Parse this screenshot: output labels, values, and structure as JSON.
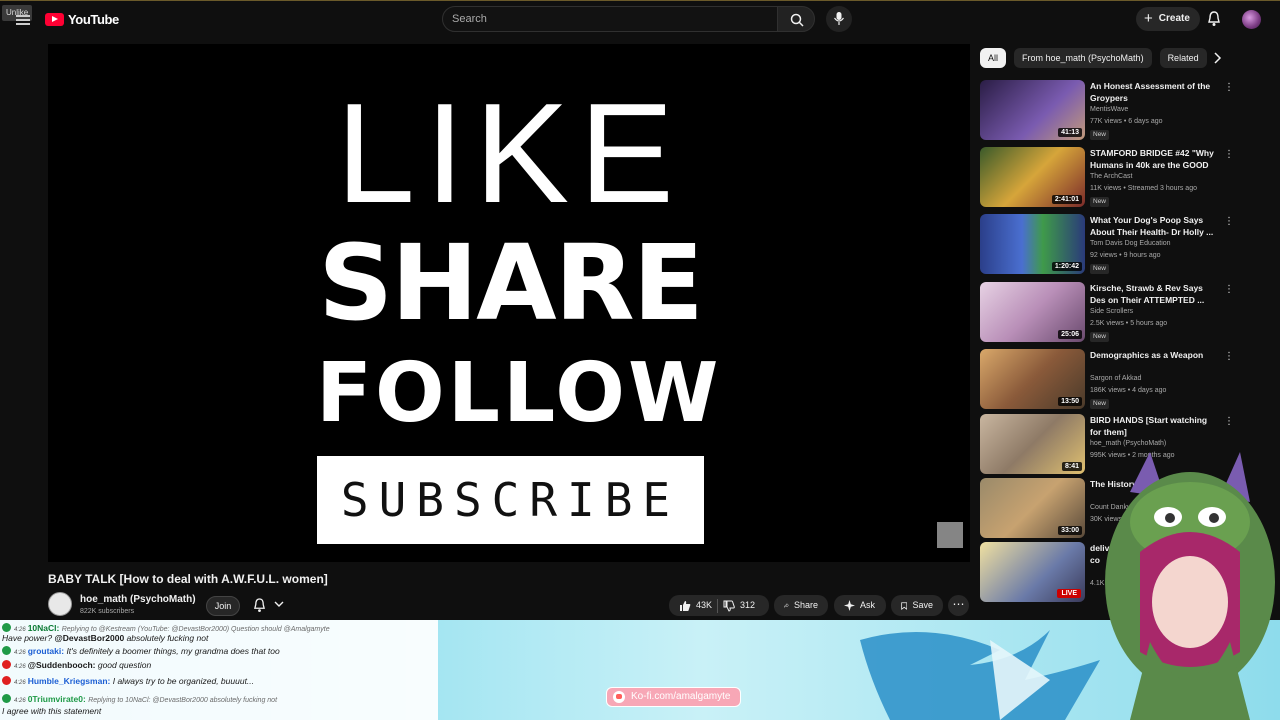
{
  "header": {
    "tooltip": "Unlike",
    "logo_text": "YouTube",
    "search_placeholder": "Search",
    "create_label": "Create",
    "colors": {
      "brand_red": "#ff0033",
      "background": "#0f0f0f"
    }
  },
  "player": {
    "promo_like": "LIKE",
    "promo_share": "SHARE",
    "promo_follow": "FOLLOW",
    "promo_subscribe": "SUBSCRIBE"
  },
  "video": {
    "title": "BABY TALK [How to deal with A.W.F.U.L. women]",
    "channel": "hoe_math (PsychoMath)",
    "subscribers": "822K subscribers",
    "join_label": "Join",
    "likes": "43K",
    "dislikes": "312",
    "share_label": "Share",
    "ask_label": "Ask",
    "save_label": "Save"
  },
  "sidebar": {
    "chips": [
      "All",
      "From hoe_math (PsychoMath)",
      "Related"
    ],
    "items": [
      {
        "title": "An Honest Assessment of the Groypers",
        "channel": "MentisWave",
        "meta": "77K views • 6 days ago",
        "badge": "New",
        "duration": "41:13",
        "thumb_color": "#5a3f7a"
      },
      {
        "title": "STAMFORD BRIDGE #42 \"Why Humans in 40k are the GOOD ...",
        "channel": "The ArchCast",
        "meta": "11K views • Streamed 3 hours ago",
        "badge": "New",
        "duration": "2:41:01",
        "thumb_color": "#b98a2c"
      },
      {
        "title": "What Your Dog's Poop Says About Their Health- Dr Holly ...",
        "channel": "Tom Davis Dog Education",
        "meta": "92 views • 9 hours ago",
        "badge": "New",
        "duration": "1:20:42",
        "thumb_color": "#3a4fa0"
      },
      {
        "title": "Kirsche, Strawb & Rev Says Des on Their ATTEMPTED ...",
        "channel": "Side Scrollers",
        "meta": "2.5K views • 5 hours ago",
        "badge": "New",
        "duration": "25:06",
        "thumb_color": "#c9a3c7"
      },
      {
        "title": "Demographics as a Weapon",
        "channel": "Sargon of Akkad",
        "meta": "186K views • 4 days ago",
        "badge": "New",
        "duration": "13:50",
        "thumb_color": "#a87f4a"
      },
      {
        "title": "BIRD HANDS [Start watching for them]",
        "channel": "hoe_math (PsychoMath)",
        "meta": "995K views • 2 months ago",
        "badge": "",
        "duration": "8:41",
        "thumb_color": "#8e7a66"
      },
      {
        "title": "The History of Racist Adverts",
        "channel": "Count Dankula",
        "meta": "30K views",
        "badge": "",
        "duration": "33:00",
        "thumb_color": "#6f7d5a"
      },
      {
        "title": "deliveries from easy delivery co",
        "channel": "",
        "meta": "4.1K",
        "badge": "",
        "duration": "",
        "live": "LIVE",
        "thumb_color": "#6a7aa8"
      }
    ]
  },
  "chat": {
    "messages": [
      {
        "user": "10NaCl:",
        "quote": "Replying to @Kestream (YouTube: @DevastBor2000) Question should @Amalgamyte",
        "text": "Have power?",
        "time": "4:26",
        "user_color": "#0a7a33"
      },
      {
        "user": "@DevastBor2000",
        "quote": "",
        "text": "absolutely fucking not",
        "time": "",
        "user_color": "#1a1a1a"
      },
      {
        "user": "groutaki:",
        "quote": "",
        "text": "It's definitely a boomer things, my grandma does that too",
        "time": "4:26",
        "user_color": "#1c5fd4"
      },
      {
        "user": "@Suddenbooch:",
        "quote": "",
        "text": "good question",
        "time": "4:26",
        "user_color": "#1a1a1a"
      },
      {
        "user": "Humble_Kriegsman:",
        "quote": "",
        "text": "I always try to be organized, buuuut...",
        "time": "4:26",
        "user_color": "#1c5fd4"
      },
      {
        "user": "0Triumvirate0:",
        "quote": "Replying to 10NaCl: @DevastBor2000 absolutely fucking not",
        "text": "I agree with this statement",
        "time": "4:26",
        "user_color": "#1f9a47"
      }
    ],
    "kofi": "Ko-fi.com/amalgamyte",
    "colors": {
      "overlay": "#8edcec",
      "kofi": "#f7a7b6"
    }
  }
}
